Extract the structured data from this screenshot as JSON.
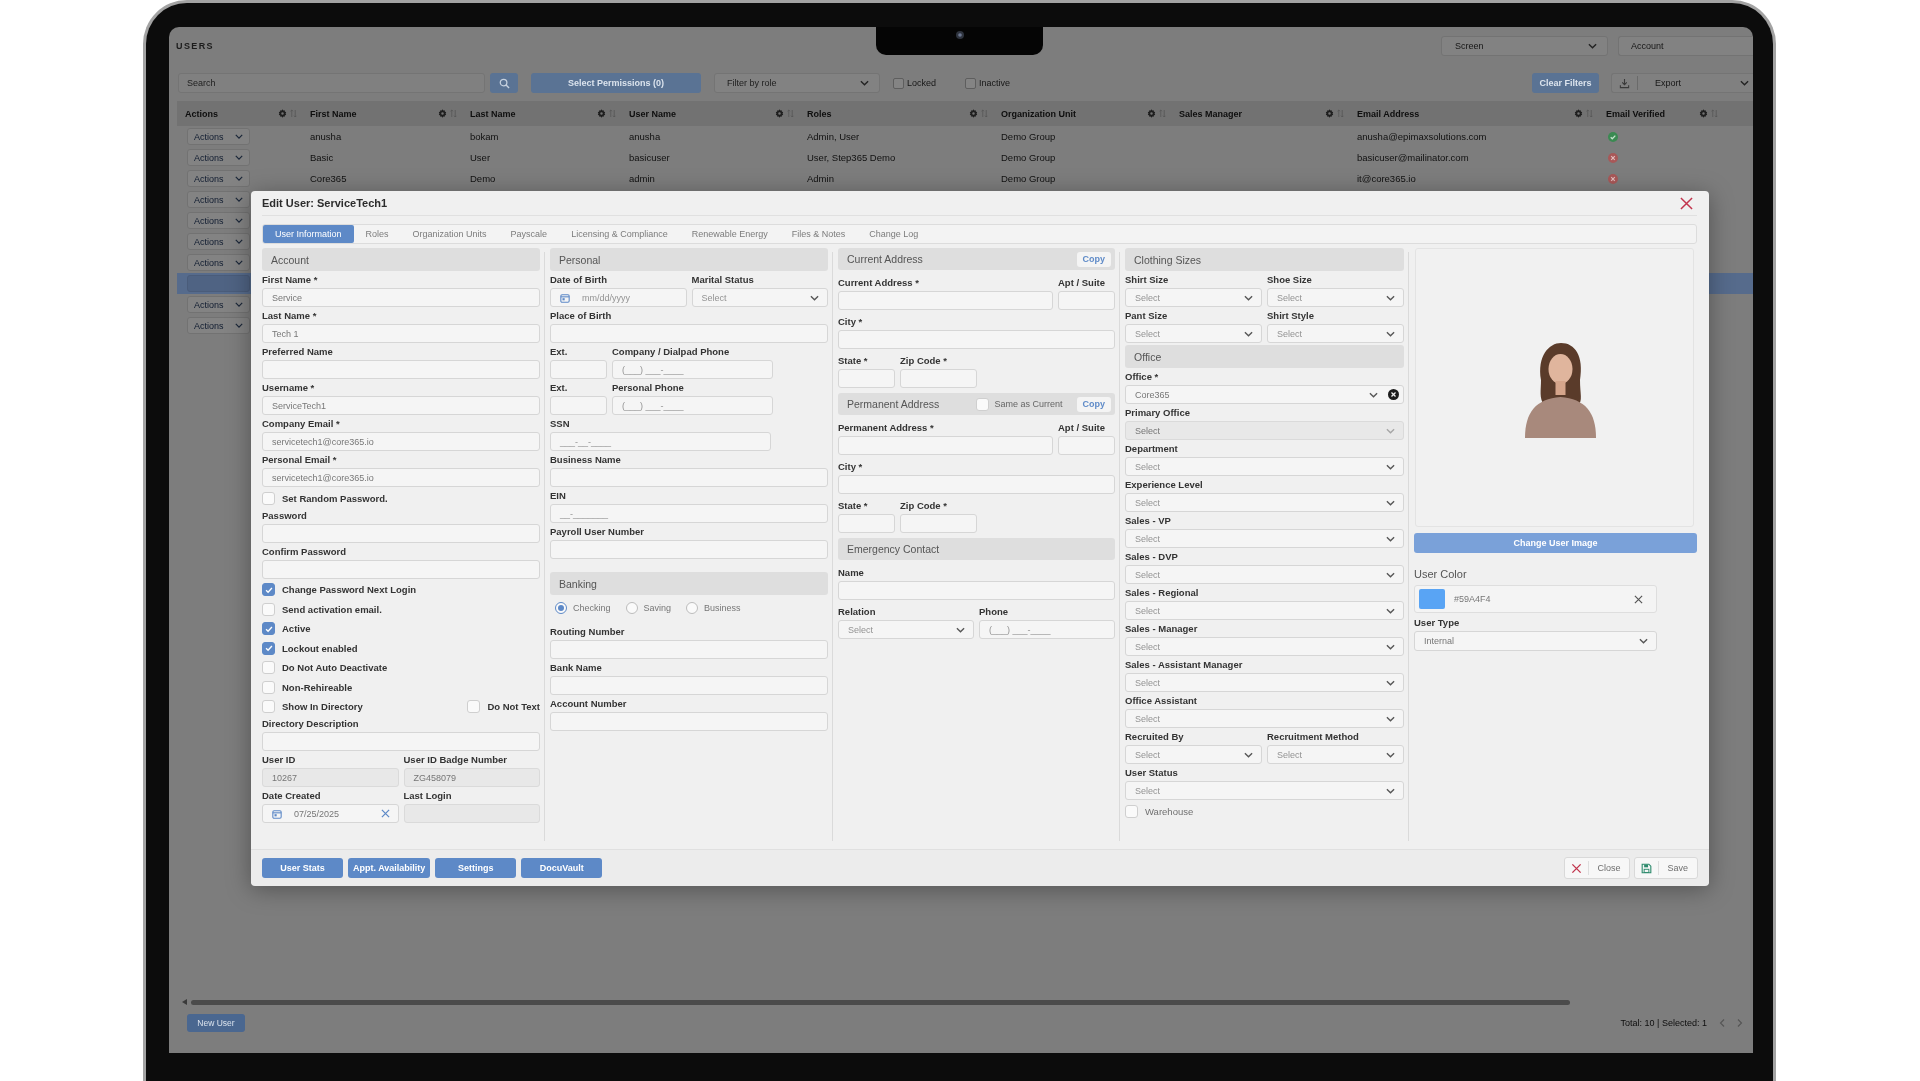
{
  "app": {
    "title": "USERS",
    "screen_select": {
      "value": "Screen"
    },
    "account_select": {
      "value": "Account"
    }
  },
  "toolbar": {
    "search": {
      "placeholder": "Search"
    },
    "permissions_button": "Select Permissions (0)",
    "role_filter": {
      "placeholder": "Filter by role"
    },
    "filters": [
      {
        "label": "Locked",
        "checked": false
      },
      {
        "label": "Inactive",
        "checked": false
      }
    ],
    "clear_button": "Clear Filters",
    "export_button": "Export"
  },
  "table": {
    "columns": [
      "Actions",
      "First Name",
      "Last Name",
      "User Name",
      "Roles",
      "Organization Unit",
      "Sales Manager",
      "Email Address",
      "Email Verified"
    ],
    "rows": [
      {
        "action": "Actions",
        "first_name": "anusha",
        "last_name": "bokam",
        "user_name": "anusha",
        "roles": "Admin, User",
        "organization_unit": "Demo Group",
        "email_address": "anusha@epimaxsolutions.com",
        "email_verified": true,
        "selected": false
      },
      {
        "action": "Actions",
        "first_name": "Basic",
        "last_name": "User",
        "user_name": "basicuser",
        "roles": "User, Step365 Demo",
        "organization_unit": "Demo Group",
        "email_address": "basicuser@mailinator.com",
        "email_verified": false,
        "selected": false
      },
      {
        "action": "Actions",
        "first_name": "Core365",
        "last_name": "Demo",
        "user_name": "admin",
        "roles": "Admin",
        "organization_unit": "Demo Group",
        "email_address": "it@core365.io",
        "email_verified": false,
        "selected": false
      },
      {
        "action": "Actions",
        "selected": false
      },
      {
        "action": "Actions",
        "selected": false
      },
      {
        "action": "Actions",
        "selected": false
      },
      {
        "action": "Actions",
        "selected": false
      },
      {
        "selected": true
      },
      {
        "action": "Actions",
        "selected": false
      },
      {
        "action": "Actions",
        "selected": false
      }
    ]
  },
  "bottom_bar": {
    "new_button": "New User",
    "summary": "Total: 10 | Selected: 1"
  },
  "dialog": {
    "title": "Edit User: ServiceTech1",
    "tabs": [
      {
        "label": "User Information",
        "selected": true
      },
      {
        "label": "Roles",
        "selected": false
      },
      {
        "label": "Organization Units",
        "selected": false
      },
      {
        "label": "Payscale",
        "selected": false
      },
      {
        "label": "Licensing & Compliance",
        "selected": false
      },
      {
        "label": "Renewable Energy",
        "selected": false
      },
      {
        "label": "Files & Notes",
        "selected": false
      },
      {
        "label": "Change Log",
        "selected": false
      }
    ],
    "columns": [
      [
        {
          "kind": "heading",
          "title": "Account"
        },
        {
          "kind": "text",
          "label": "First Name *",
          "value": "Service",
          "disabled": false
        },
        {
          "kind": "text",
          "label": "Last Name *",
          "value": "Tech 1",
          "disabled": false
        },
        {
          "kind": "text",
          "label": "Preferred Name",
          "disabled": false
        },
        {
          "kind": "text",
          "label": "Username *",
          "value": "ServiceTech1",
          "disabled": false
        },
        {
          "kind": "text",
          "label": "Company Email *",
          "value": "servicetech1@core365.io",
          "disabled": false
        },
        {
          "kind": "text",
          "label": "Personal Email *",
          "value": "servicetech1@core365.io",
          "disabled": false
        },
        {
          "kind": "checkbox",
          "label": "Set Random Password.",
          "checked": false
        },
        {
          "kind": "text",
          "label": "Password",
          "disabled": false
        },
        {
          "kind": "text",
          "label": "Confirm Password",
          "disabled": false
        },
        {
          "kind": "checkbox",
          "label": "Change Password Next Login",
          "checked": true
        },
        {
          "kind": "checkbox",
          "label": "Send activation email.",
          "checked": false
        },
        {
          "kind": "checkbox",
          "label": "Active",
          "checked": true
        },
        {
          "kind": "checkbox",
          "label": "Lockout enabled",
          "checked": true
        },
        {
          "kind": "checkbox",
          "label": "Do Not Auto Deactivate",
          "checked": false
        },
        {
          "kind": "checkbox",
          "label": "Non-Rehireable",
          "checked": false
        },
        {
          "kind": "pair",
          "items": [
            {
              "kind": "checkbox",
              "label": "Show In Directory",
              "checked": false
            },
            {
              "kind": "checkbox",
              "label": "Do Not Text",
              "checked": false
            }
          ]
        },
        {
          "kind": "text",
          "label": "Directory Description",
          "disabled": false
        },
        {
          "kind": "pair",
          "items": [
            {
              "kind": "text",
              "label": "User ID",
              "value": "10267",
              "disabled": true
            },
            {
              "kind": "text",
              "label": "User ID Badge Number",
              "value": "ZG458079",
              "disabled": true
            }
          ]
        },
        {
          "kind": "pair",
          "items": [
            {
              "kind": "date",
              "label": "Date Created",
              "value": "07/25/2025",
              "clearable": true,
              "disabled": false
            },
            {
              "kind": "text",
              "label": "Last Login",
              "disabled": true
            }
          ]
        }
      ],
      [
        {
          "kind": "heading",
          "title": "Personal"
        },
        {
          "kind": "pair",
          "items": [
            {
              "kind": "date",
              "label": "Date of Birth",
              "placeholder": "mm/dd/yyyy",
              "clearable": false,
              "disabled": false
            },
            {
              "kind": "select",
              "label": "Marital Status",
              "placeholder": "Select",
              "clearable": false,
              "disabled": false
            }
          ]
        },
        {
          "kind": "text",
          "label": "Place of Birth",
          "disabled": false
        },
        {
          "kind": "pair",
          "items": [
            {
              "kind": "short",
              "label": "Ext.",
              "disabled": false
            },
            {
              "kind": "phone",
              "label": "Company / Dialpad Phone",
              "placeholder": "(___) ___-____",
              "disabled": false
            }
          ]
        },
        {
          "kind": "pair",
          "items": [
            {
              "kind": "short",
              "label": "Ext.",
              "disabled": false
            },
            {
              "kind": "phone",
              "label": "Personal Phone",
              "placeholder": "(___) ___-____",
              "disabled": false
            }
          ]
        },
        {
          "kind": "masked",
          "label": "SSN",
          "placeholder": "___-__-____",
          "disabled": false
        },
        {
          "kind": "text",
          "label": "Business Name",
          "disabled": false
        },
        {
          "kind": "text",
          "label": "EIN",
          "placeholder": "__-_______",
          "disabled": false
        },
        {
          "kind": "text",
          "label": "Payroll User Number",
          "disabled": false
        },
        {
          "kind": "heading",
          "title": "Banking"
        },
        {
          "kind": "radios",
          "options": [
            {
              "label": "Checking",
              "selected": true
            },
            {
              "label": "Saving",
              "selected": false
            },
            {
              "label": "Business",
              "selected": false
            }
          ]
        },
        {
          "kind": "text",
          "label": "Routing Number",
          "disabled": false
        },
        {
          "kind": "text",
          "label": "Bank Name",
          "disabled": false
        },
        {
          "kind": "text",
          "label": "Account Number",
          "disabled": false
        }
      ],
      [
        {
          "kind": "heading",
          "title": "Current Address",
          "button": "Copy"
        },
        {
          "kind": "pair",
          "items": [
            {
              "kind": "text",
              "label": "Current Address *",
              "disabled": false
            },
            {
              "kind": "short",
              "label": "Apt / Suite",
              "disabled": false
            }
          ]
        },
        {
          "kind": "text",
          "label": "City *",
          "disabled": false
        },
        {
          "kind": "pair",
          "items": [
            {
              "kind": "short",
              "label": "State *",
              "disabled": false
            },
            {
              "kind": "text",
              "label": "Zip Code *",
              "disabled": false
            }
          ]
        },
        {
          "kind": "heading",
          "title": "Permanent Address",
          "option": {
            "label": "Same as Current",
            "checked": false
          },
          "button": "Copy"
        },
        {
          "kind": "pair",
          "items": [
            {
              "kind": "text",
              "label": "Permanent Address *",
              "disabled": false
            },
            {
              "kind": "short",
              "label": "Apt / Suite",
              "disabled": false
            }
          ]
        },
        {
          "kind": "text",
          "label": "City *",
          "disabled": false
        },
        {
          "kind": "pair",
          "items": [
            {
              "kind": "short",
              "label": "State *",
              "disabled": false
            },
            {
              "kind": "text",
              "label": "Zip Code *",
              "disabled": false
            }
          ]
        },
        {
          "kind": "heading",
          "title": "Emergency Contact"
        },
        {
          "kind": "text",
          "label": "Name",
          "disabled": false
        },
        {
          "kind": "pair",
          "items": [
            {
              "kind": "select",
              "label": "Relation",
              "placeholder": "Select",
              "clearable": false,
              "disabled": false
            },
            {
              "kind": "phone",
              "label": "Phone",
              "placeholder": "(___) ___-____",
              "disabled": false
            }
          ]
        }
      ],
      [
        {
          "kind": "heading",
          "title": "Clothing Sizes"
        },
        {
          "kind": "pair",
          "items": [
            {
              "kind": "select",
              "label": "Shirt Size",
              "placeholder": "Select",
              "clearable": false,
              "disabled": false
            },
            {
              "kind": "select",
              "label": "Shoe Size",
              "placeholder": "Select",
              "clearable": false,
              "disabled": false
            }
          ]
        },
        {
          "kind": "pair",
          "items": [
            {
              "kind": "select",
              "label": "Pant Size",
              "placeholder": "Select",
              "clearable": false,
              "disabled": false
            },
            {
              "kind": "select",
              "label": "Shirt Style",
              "placeholder": "Select",
              "clearable": false,
              "disabled": false
            }
          ]
        },
        {
          "kind": "heading",
          "title": "Office"
        },
        {
          "kind": "select",
          "label": "Office *",
          "value": "Core365",
          "clearable": true,
          "disabled": false
        },
        {
          "kind": "select",
          "label": "Primary Office",
          "placeholder": "Select",
          "clearable": false,
          "disabled": true
        },
        {
          "kind": "select",
          "label": "Department",
          "placeholder": "Select",
          "clearable": false,
          "disabled": false
        },
        {
          "kind": "select",
          "label": "Experience Level",
          "placeholder": "Select",
          "clearable": false,
          "disabled": false
        },
        {
          "kind": "select",
          "label": "Sales - VP",
          "placeholder": "Select",
          "clearable": false,
          "disabled": false
        },
        {
          "kind": "select",
          "label": "Sales - DVP",
          "placeholder": "Select",
          "clearable": false,
          "disabled": false
        },
        {
          "kind": "select",
          "label": "Sales - Regional",
          "placeholder": "Select",
          "clearable": false,
          "disabled": false
        },
        {
          "kind": "select",
          "label": "Sales - Manager",
          "placeholder": "Select",
          "clearable": false,
          "disabled": false
        },
        {
          "kind": "select",
          "label": "Sales - Assistant Manager",
          "placeholder": "Select",
          "clearable": false,
          "disabled": false
        },
        {
          "kind": "select",
          "label": "Office Assistant",
          "placeholder": "Select",
          "clearable": false,
          "disabled": false
        },
        {
          "kind": "pair",
          "items": [
            {
              "kind": "select",
              "label": "Recruited By",
              "placeholder": "Select",
              "clearable": false,
              "disabled": false
            },
            {
              "kind": "select",
              "label": "Recruitment Method",
              "placeholder": "Select",
              "clearable": false,
              "disabled": false
            }
          ]
        },
        {
          "kind": "select",
          "label": "User Status",
          "placeholder": "Select",
          "clearable": false,
          "disabled": false
        },
        {
          "kind": "checkbox",
          "label": "Warehouse",
          "checked": false
        }
      ]
    ],
    "profile": {
      "change_image_button": "Change User Image",
      "user_color": {
        "label": "User Color",
        "value": "#59A4F4",
        "color": "#59a4f4"
      },
      "user_type": {
        "label": "User Type",
        "value": "Internal"
      }
    },
    "buttons": [
      "User Stats",
      "Appt. Availability",
      "Settings",
      "DocuVault"
    ],
    "close_button": "Close",
    "save_button": "Save"
  }
}
